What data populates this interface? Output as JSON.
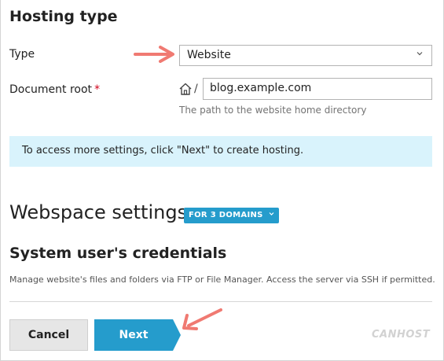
{
  "hosting": {
    "title": "Hosting type",
    "type_label": "Type",
    "type_value": "Website",
    "docroot_label": "Document root",
    "docroot_required": "*",
    "docroot_prefix": "/",
    "docroot_value": "blog.example.com",
    "docroot_hint": "The path to the website home directory"
  },
  "info": {
    "message": "To access more settings, click \"Next\" to create hosting."
  },
  "webspace": {
    "title": "Webspace settings",
    "domains_button": "FOR 3 DOMAINS"
  },
  "credentials": {
    "title": "System user's credentials",
    "description": "Manage website's files and folders via FTP or File Manager. Access the server via SSH if permitted."
  },
  "footer": {
    "cancel_label": "Cancel",
    "next_label": "Next",
    "brand": "CANHOST"
  },
  "colors": {
    "accent": "#259ccc",
    "info_bg": "#d9f3fc",
    "annotation_arrow": "#f07a72"
  },
  "icons": [
    "home-icon",
    "chevron-down-icon",
    "annotation-arrow"
  ]
}
